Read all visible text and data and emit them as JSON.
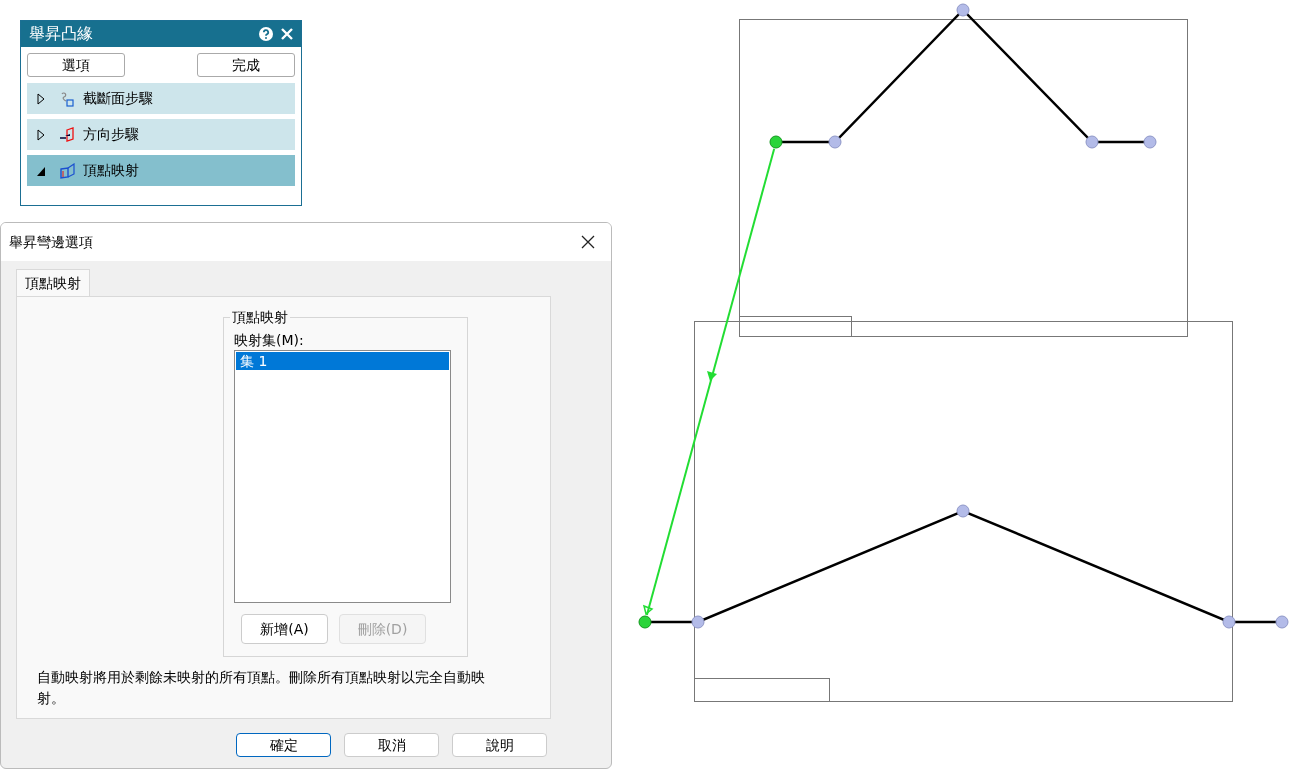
{
  "panel": {
    "title": "舉昇凸緣",
    "buttons": [
      "選項",
      "完成"
    ],
    "steps": [
      {
        "label": "截斷面步驟",
        "expanded": false,
        "selected": false
      },
      {
        "label": "方向步驟",
        "expanded": false,
        "selected": false
      },
      {
        "label": "頂點映射",
        "expanded": true,
        "selected": true
      }
    ]
  },
  "dialog": {
    "title": "舉昇彎邊選項",
    "tabs": [
      {
        "label": "頂點映射",
        "selected": true
      }
    ],
    "group": {
      "legend": "頂點映射",
      "list_label": "映射集(M):",
      "items": [
        {
          "label": "集 1",
          "selected": true
        }
      ],
      "buttons": [
        {
          "label": "新增(A)",
          "disabled": false
        },
        {
          "label": "刪除(D)",
          "disabled": true
        }
      ]
    },
    "note": "自動映射將用於剩餘未映射的所有頂點。刪除所有頂點映射以完全自動映射。",
    "footer_buttons": [
      {
        "label": "確定",
        "default": true
      },
      {
        "label": "取消",
        "default": false
      },
      {
        "label": "說明",
        "default": false
      }
    ]
  }
}
